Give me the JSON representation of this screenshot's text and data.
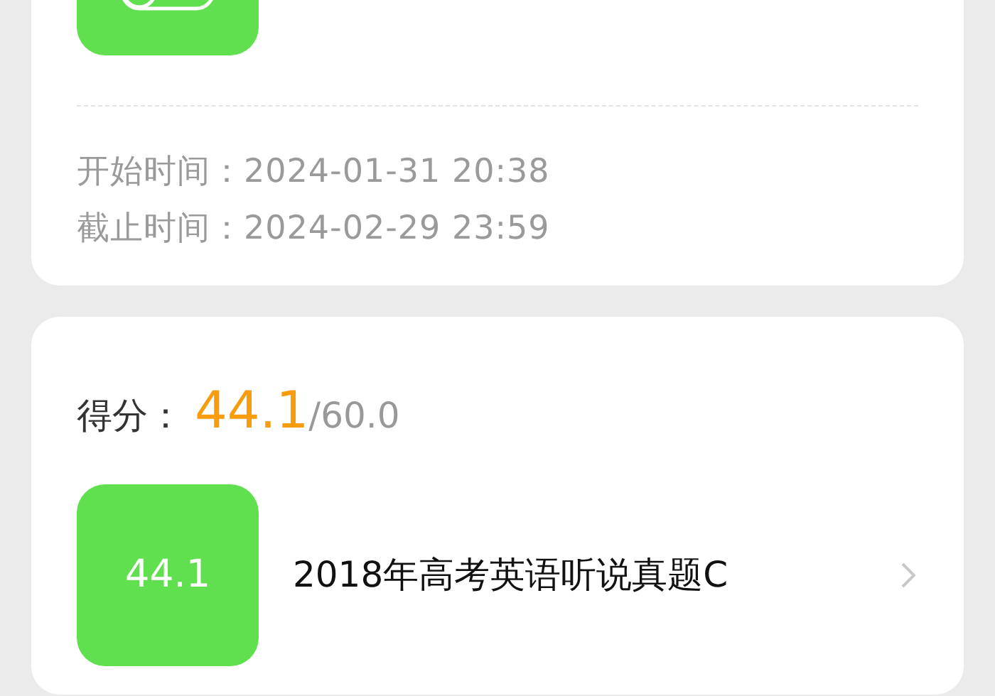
{
  "task": {
    "times": [
      {
        "label": "开始时间：",
        "value": "2024-01-31 20:38"
      },
      {
        "label": "截止时间：",
        "value": "2024-02-29 23:59"
      }
    ]
  },
  "result": {
    "score_label": "得分：",
    "score": "44.1",
    "total": "/60.0",
    "items": [
      {
        "score": "44.1",
        "title": "2018年高考英语听说真题C"
      }
    ]
  }
}
